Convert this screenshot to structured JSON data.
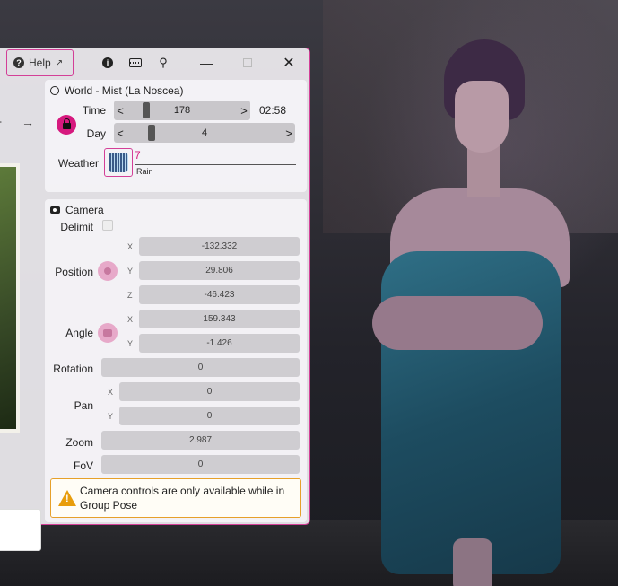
{
  "titlebar": {
    "help_label": "Help",
    "icons": [
      "info-icon",
      "keyboard-icon",
      "pin-icon",
      "minimize-icon",
      "maximize-icon",
      "close-icon"
    ]
  },
  "world": {
    "header": "World  -  Mist (La Noscea)",
    "time_label": "Time",
    "time_value": "178",
    "time_text": "02:58",
    "day_label": "Day",
    "day_value": "4",
    "weather_label": "Weather",
    "weather_id": "7",
    "weather_name": "Rain"
  },
  "camera": {
    "header": "Camera",
    "delimit_label": "Delimit",
    "position_label": "Position",
    "position": {
      "x": "-132.332",
      "y": "29.806",
      "z": "-46.423"
    },
    "angle_label": "Angle",
    "angle": {
      "x": "159.343",
      "y": "-1.426"
    },
    "rotation_label": "Rotation",
    "rotation": "0",
    "pan_label": "Pan",
    "pan": {
      "x": "0",
      "y": "0"
    },
    "zoom_label": "Zoom",
    "zoom": "2.987",
    "fov_label": "FoV",
    "fov": "0",
    "axis": {
      "x": "X",
      "y": "Y",
      "z": "Z"
    }
  },
  "notice": {
    "text": "Camera controls are only available while in Group Pose"
  },
  "colors": {
    "accent": "#d33f97",
    "warning": "#e6a02a"
  }
}
